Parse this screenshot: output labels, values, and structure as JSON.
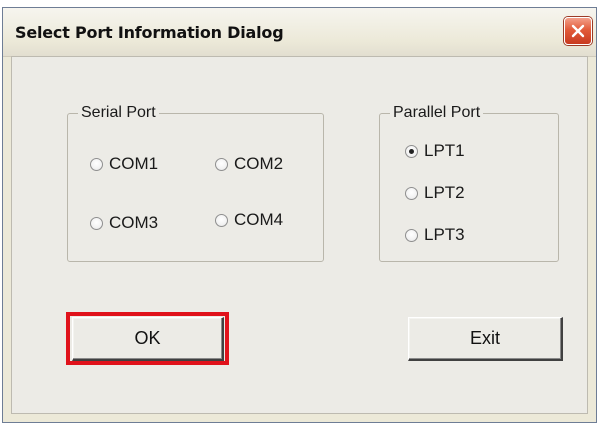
{
  "window": {
    "title": "Select Port Information Dialog",
    "close_icon": "close-icon"
  },
  "serial_port": {
    "label": "Serial Port",
    "options": [
      {
        "label": "COM1",
        "checked": false
      },
      {
        "label": "COM2",
        "checked": false
      },
      {
        "label": "COM3",
        "checked": false
      },
      {
        "label": "COM4",
        "checked": false
      }
    ]
  },
  "parallel_port": {
    "label": "Parallel Port",
    "options": [
      {
        "label": "LPT1",
        "checked": true
      },
      {
        "label": "LPT2",
        "checked": false
      },
      {
        "label": "LPT3",
        "checked": false
      }
    ]
  },
  "buttons": {
    "ok_label": "OK",
    "exit_label": "Exit"
  },
  "colors": {
    "highlight": "#e0121b",
    "close_button": "#e25b3a",
    "dialog_bg": "#ecebe6"
  }
}
